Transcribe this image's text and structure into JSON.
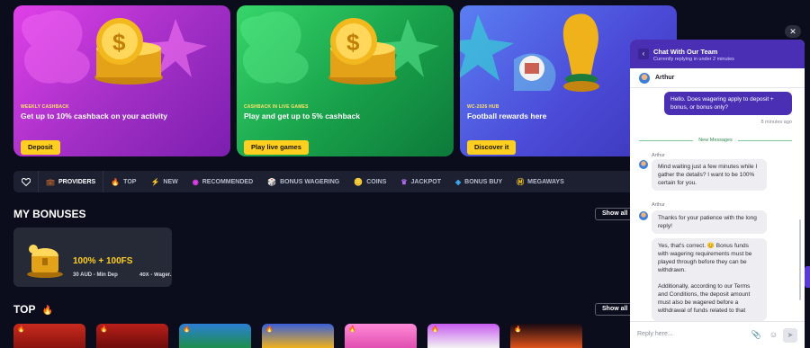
{
  "promos": [
    {
      "kicker": "WEEKLY CASHBACK",
      "title": "Get up to 10% cashback on your activity",
      "cta": "Deposit"
    },
    {
      "kicker": "CASHBACK IN LIVE GAMES",
      "title": "Play and get up to 5% cashback",
      "cta": "Play live games"
    },
    {
      "kicker": "WC-2026 HUB",
      "title": "Football rewards here",
      "cta": "Discover it"
    }
  ],
  "categories": [
    {
      "label": "PROVIDERS",
      "icon": "briefcase-icon",
      "glyph": "💼"
    },
    {
      "label": "TOP",
      "icon": "fire-icon",
      "glyph": "🔥"
    },
    {
      "label": "NEW",
      "icon": "lightning-icon",
      "glyph": "⚡"
    },
    {
      "label": "RECOMMENDED",
      "icon": "badge-icon",
      "glyph": "◉"
    },
    {
      "label": "BONUS WAGERING",
      "icon": "dice-icon",
      "glyph": "🎲"
    },
    {
      "label": "COINS",
      "icon": "coin-icon",
      "glyph": "🪙"
    },
    {
      "label": "JACKPOT",
      "icon": "crown-icon",
      "glyph": "♛"
    },
    {
      "label": "BONUS BUY",
      "icon": "gem-icon",
      "glyph": "◈"
    },
    {
      "label": "MEGAWAYS",
      "icon": "m-icon",
      "glyph": "Ⓜ"
    }
  ],
  "bonuses": {
    "title": "MY BONUSES",
    "show_all": "Show all",
    "card": {
      "amount": "100% + 100FS",
      "min_dep": "30 AUD - Min Dep",
      "wager": "40X - Wager..."
    }
  },
  "top": {
    "title": "TOP",
    "show_all": "Show all"
  },
  "chat": {
    "title": "Chat With Our Team",
    "subtitle": "Currently replying in under 2 minutes",
    "agent": "Arthur",
    "outgoing": "Hello. Does wagering apply to deposit + bonus, or bonus only?",
    "outgoing_time": "8 minutes ago",
    "divider": "New Messages",
    "messages": [
      {
        "sender": "Arthur",
        "text": "Mind waiting just a few minutes while I gather the details? I want to be 100% certain for you."
      },
      {
        "sender": "Arthur",
        "text": "Thanks for your patience with the long reply!"
      },
      {
        "sender": "",
        "text": "Yes, that's correct. 😊 Bonus funds with wagering requirements must be played through before they can be withdrawn."
      },
      {
        "sender": "",
        "text": "Additionally, according to our Terms and Conditions, the deposit amount must also be wagered before a withdrawal of funds related to that"
      }
    ],
    "input_placeholder": "Reply here..."
  },
  "colors": {
    "accent": "#ffcf1f",
    "chat_brand": "#4a2fb4",
    "page_bg": "#0b0d1d"
  }
}
